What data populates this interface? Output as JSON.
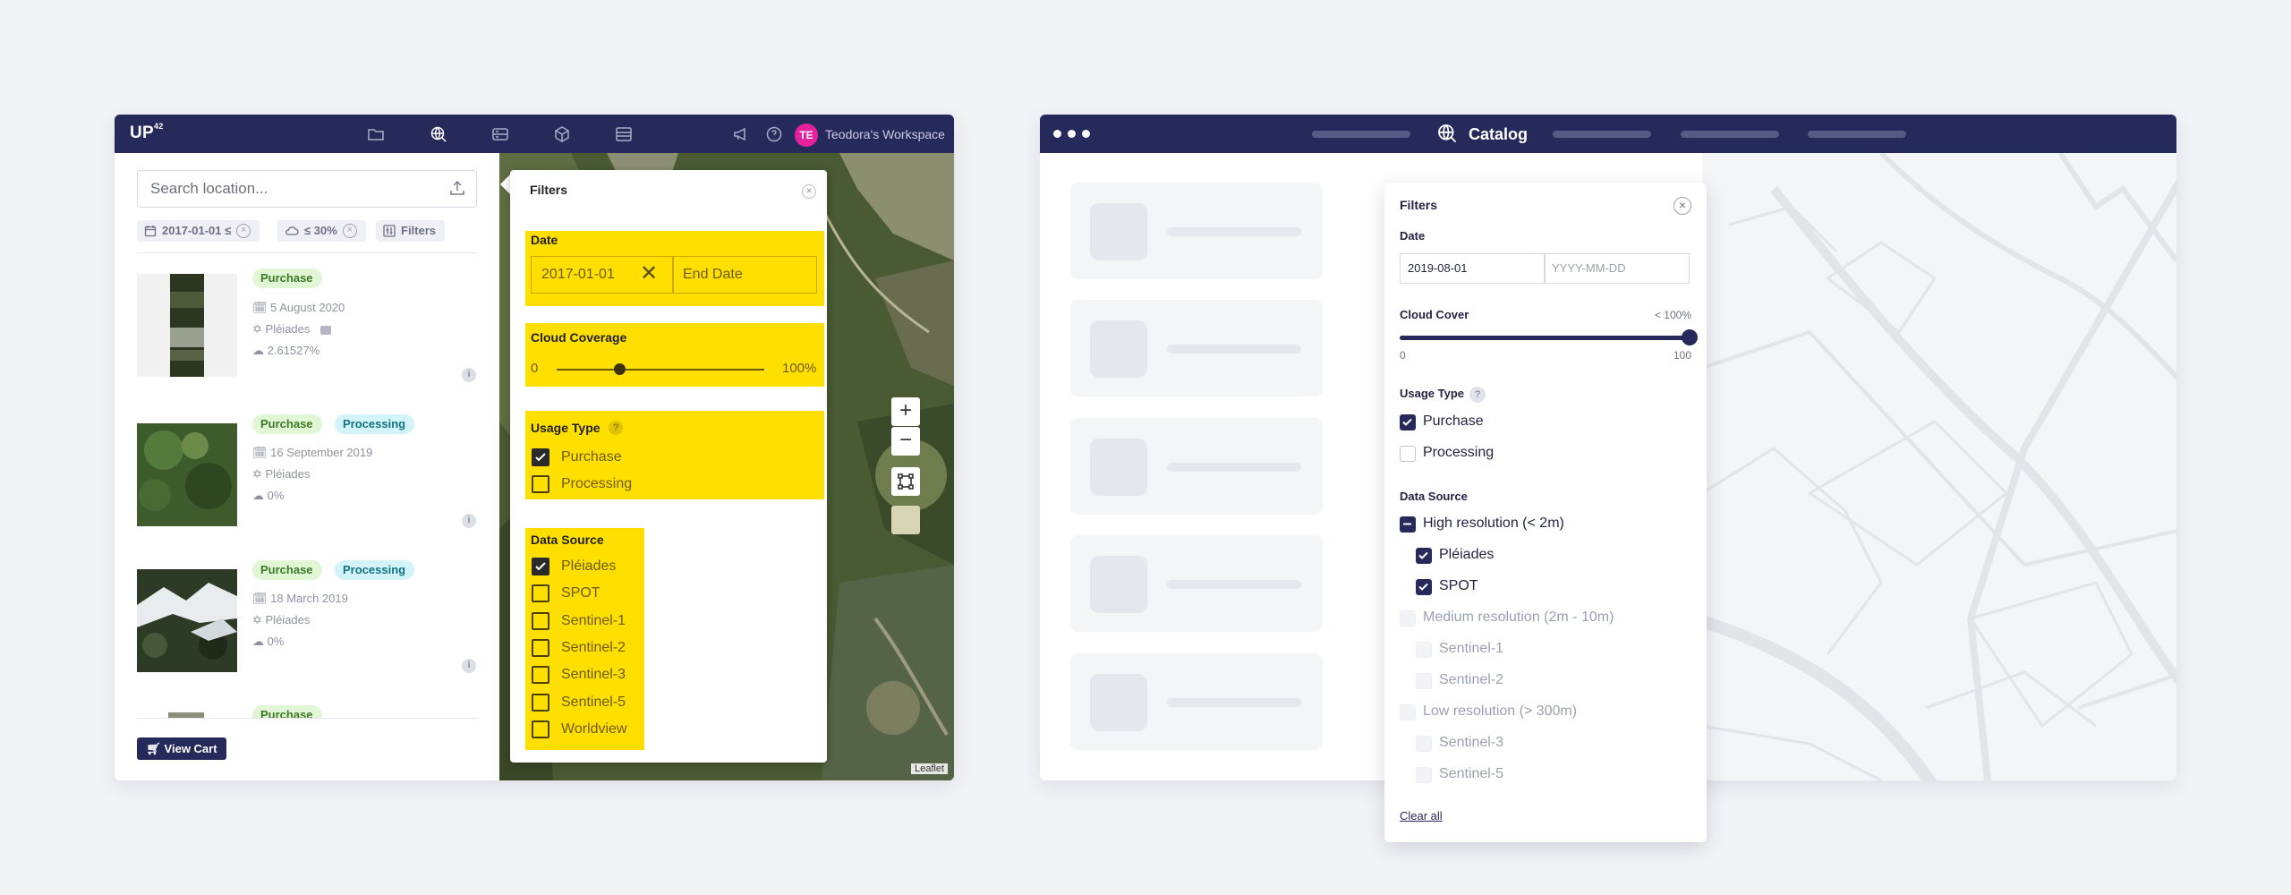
{
  "left_window": {
    "logo": "UP",
    "logo_sup": "42",
    "workspace": {
      "initials": "TE",
      "name": "Teodora's Workspace"
    },
    "search": {
      "placeholder": "Search location..."
    },
    "chips": {
      "date": "2017-01-01 ≤",
      "cloud": "≤ 30%",
      "filters": "Filters",
      "clear": "×"
    },
    "results": [
      {
        "tags": [
          "Purchase"
        ],
        "date": "5 August 2020",
        "sensor": "Pléiades",
        "cloud": "2.61527%"
      },
      {
        "tags": [
          "Purchase",
          "Processing"
        ],
        "date": "16 September 2019",
        "sensor": "Pléiades",
        "cloud": "0%"
      },
      {
        "tags": [
          "Purchase",
          "Processing"
        ],
        "date": "18 March 2019",
        "sensor": "Pléiades",
        "cloud": "0%"
      },
      {
        "tags": [
          "Purchase"
        ]
      }
    ],
    "info_glyph": "i",
    "view_cart": "View Cart",
    "filters": {
      "title": "Filters",
      "close": "×",
      "date_label": "Date",
      "date_start": "2017-01-01",
      "date_end_placeholder": "End Date",
      "cloud_label": "Cloud Coverage",
      "cloud_min": "0",
      "cloud_max": "100%",
      "cloud_value_pct": 30,
      "usage_label": "Usage Type",
      "help": "?",
      "usage": [
        {
          "label": "Purchase",
          "checked": true
        },
        {
          "label": "Processing",
          "checked": false
        }
      ],
      "source_label": "Data Source",
      "sources": [
        {
          "label": "Pléiades",
          "checked": true
        },
        {
          "label": "SPOT",
          "checked": false
        },
        {
          "label": "Sentinel-1",
          "checked": false
        },
        {
          "label": "Sentinel-2",
          "checked": false
        },
        {
          "label": "Sentinel-3",
          "checked": false
        },
        {
          "label": "Sentinel-5",
          "checked": false
        },
        {
          "label": "Worldview",
          "checked": false
        }
      ],
      "highlight_color": "#ffdf00"
    },
    "zoom_in": "+",
    "zoom_out": "−",
    "attribution": "Leaflet"
  },
  "right_window": {
    "title": "Catalog",
    "filters": {
      "title": "Filters",
      "close": "×",
      "date_label": "Date",
      "date_start": "2019-08-01",
      "date_end_placeholder": "YYYY-MM-DD",
      "cloud_label": "Cloud Cover",
      "cloud_value": "< 100%",
      "cloud_min": "0",
      "cloud_max": "100",
      "cloud_value_pct": 100,
      "usage_label": "Usage Type",
      "help": "?",
      "usage": [
        {
          "label": "Purchase",
          "checked": true
        },
        {
          "label": "Processing",
          "checked": false
        }
      ],
      "source_label": "Data Source",
      "groups": [
        {
          "label": "High resolution (< 2m)",
          "state": "partial",
          "items": [
            {
              "label": "Pléiades",
              "checked": true
            },
            {
              "label": "SPOT",
              "checked": true
            }
          ]
        },
        {
          "label": "Medium resolution (2m - 10m)",
          "state": "disabled",
          "items": [
            {
              "label": "Sentinel-1"
            },
            {
              "label": "Sentinel-2"
            }
          ]
        },
        {
          "label": "Low resolution (> 300m)",
          "state": "disabled",
          "items": [
            {
              "label": "Sentinel-3"
            },
            {
              "label": "Sentinel-5"
            }
          ]
        }
      ],
      "clear_all": "Clear all"
    }
  },
  "colors": {
    "navy": "#262a5b",
    "page_bg": "#f2f3f6",
    "purchase_tag": "#e1f6d5",
    "processing_tag": "#d2f3f7",
    "avatar": "#e5219e"
  }
}
